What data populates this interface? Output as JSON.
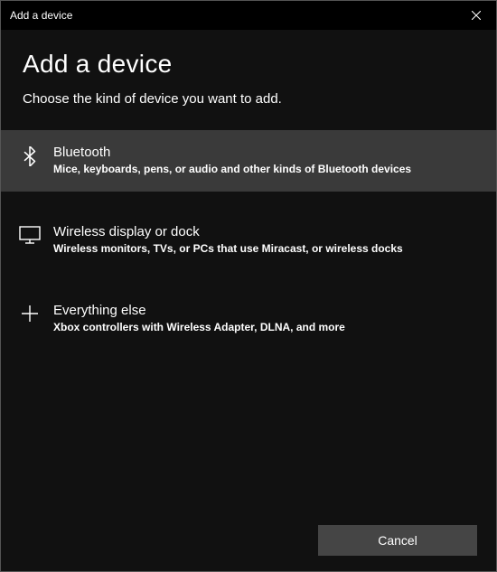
{
  "titlebar": {
    "title": "Add a device"
  },
  "header": {
    "title": "Add a device",
    "subtitle": "Choose the kind of device you want to add."
  },
  "options": [
    {
      "icon": "bluetooth-icon",
      "title": "Bluetooth",
      "desc": "Mice, keyboards, pens, or audio and other kinds of Bluetooth devices",
      "selected": true
    },
    {
      "icon": "monitor-icon",
      "title": "Wireless display or dock",
      "desc": "Wireless monitors, TVs, or PCs that use Miracast, or wireless docks",
      "selected": false
    },
    {
      "icon": "plus-icon",
      "title": "Everything else",
      "desc": "Xbox controllers with Wireless Adapter, DLNA, and more",
      "selected": false
    }
  ],
  "footer": {
    "cancel_label": "Cancel"
  }
}
